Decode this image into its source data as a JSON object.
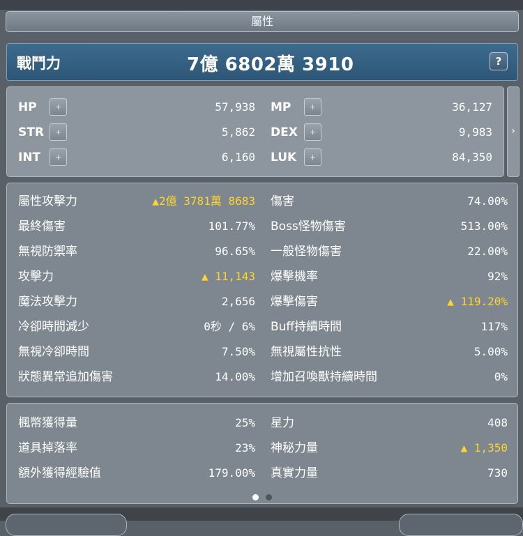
{
  "title": "屬性",
  "power": {
    "label": "戰鬥力",
    "value": "7億 6802萬 3910",
    "help_label": "?"
  },
  "side_arrow": "›",
  "ap_stats": [
    {
      "label": "HP",
      "value": "57,938",
      "plus": "+"
    },
    {
      "label": "MP",
      "value": "36,127",
      "plus": "+"
    },
    {
      "label": "STR",
      "value": "5,862",
      "plus": "+"
    },
    {
      "label": "DEX",
      "value": "9,983",
      "plus": "+"
    },
    {
      "label": "INT",
      "value": "6,160",
      "plus": "+"
    },
    {
      "label": "LUK",
      "value": "84,350",
      "plus": "+"
    }
  ],
  "detail_left": [
    {
      "label": "屬性攻擊力",
      "value": "▲2億 3781萬 8683",
      "highlight": true
    },
    {
      "label": "最終傷害",
      "value": "101.77%"
    },
    {
      "label": "無視防禦率",
      "value": "96.65%"
    },
    {
      "label": "攻擊力",
      "value": "▲ 11,143",
      "highlight": true
    },
    {
      "label": "魔法攻擊力",
      "value": "2,656"
    },
    {
      "label": "冷卻時間減少",
      "value": "0秒 / 6%"
    },
    {
      "label": "無視冷卻時間",
      "value": "7.50%"
    },
    {
      "label": "狀態異常追加傷害",
      "value": "14.00%"
    }
  ],
  "detail_right": [
    {
      "label": "傷害",
      "value": "74.00%"
    },
    {
      "label": "Boss怪物傷害",
      "value": "513.00%"
    },
    {
      "label": "一般怪物傷害",
      "value": "22.00%"
    },
    {
      "label": "爆擊機率",
      "value": "92%"
    },
    {
      "label": "爆擊傷害",
      "value": "▲ 119.20%",
      "highlight": true
    },
    {
      "label": "Buff持續時間",
      "value": "117%"
    },
    {
      "label": "無視屬性抗性",
      "value": "5.00%"
    },
    {
      "label": "增加召喚獸持續時間",
      "value": "0%"
    }
  ],
  "extra_left": [
    {
      "label": "楓幣獲得量",
      "value": "25%"
    },
    {
      "label": "道具掉落率",
      "value": "23%"
    },
    {
      "label": "額外獲得經驗值",
      "value": "179.00%"
    }
  ],
  "extra_right": [
    {
      "label": "星力",
      "value": "408"
    },
    {
      "label": "神秘力量",
      "value": "▲ 1,350",
      "highlight": true
    },
    {
      "label": "真實力量",
      "value": "730"
    }
  ],
  "page_indicator": {
    "current": 1,
    "total": 2
  },
  "colors": {
    "highlight": "#ffd52b",
    "power_bar": "#3c6b8e",
    "panel": "#8d959e"
  }
}
